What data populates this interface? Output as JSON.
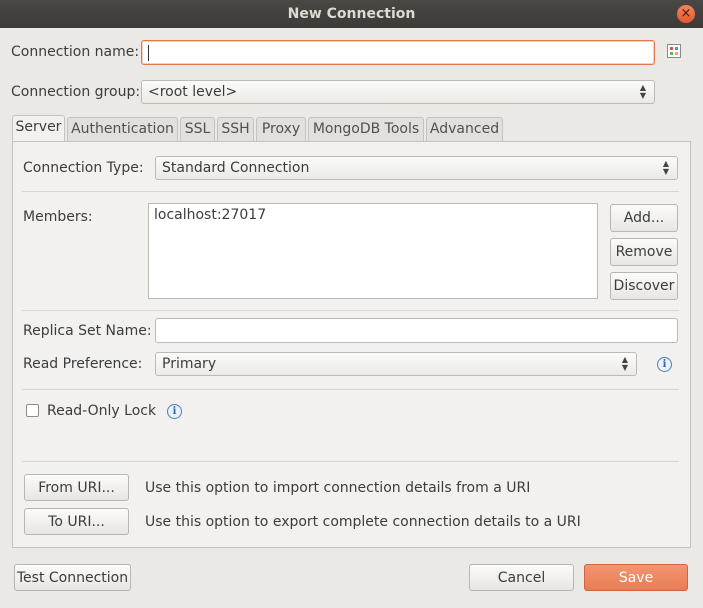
{
  "window": {
    "title": "New Connection",
    "close_glyph": "×"
  },
  "form": {
    "connection_name_label": "Connection name:",
    "connection_name_value": "",
    "connection_group_label": "Connection group:",
    "connection_group_value": "<root level>"
  },
  "tabs": [
    {
      "label": "Server",
      "active": true
    },
    {
      "label": "Authentication",
      "active": false
    },
    {
      "label": "SSL",
      "active": false
    },
    {
      "label": "SSH",
      "active": false
    },
    {
      "label": "Proxy",
      "active": false
    },
    {
      "label": "MongoDB Tools",
      "active": false
    },
    {
      "label": "Advanced",
      "active": false
    }
  ],
  "server": {
    "connection_type_label": "Connection Type:",
    "connection_type_value": "Standard Connection",
    "members_label": "Members:",
    "members": [
      "localhost:27017"
    ],
    "add_button": "Add...",
    "remove_button": "Remove",
    "discover_button": "Discover",
    "replica_set_label": "Replica Set Name:",
    "replica_set_value": "",
    "read_pref_label": "Read Preference:",
    "read_pref_value": "Primary",
    "read_only_label": "Read-Only Lock",
    "read_only_checked": false,
    "info_glyph": "i"
  },
  "uri": {
    "from_button": "From URI...",
    "from_text": "Use this option to import connection details from a URI",
    "to_button": "To URI...",
    "to_text": "Use this option to export complete connection details to a URI"
  },
  "footer": {
    "test_button": "Test Connection",
    "cancel_button": "Cancel",
    "save_button": "Save"
  },
  "colors": {
    "accent": "#ea7d55",
    "info": "#2f67b1",
    "titlebar": "#3c3b37"
  }
}
